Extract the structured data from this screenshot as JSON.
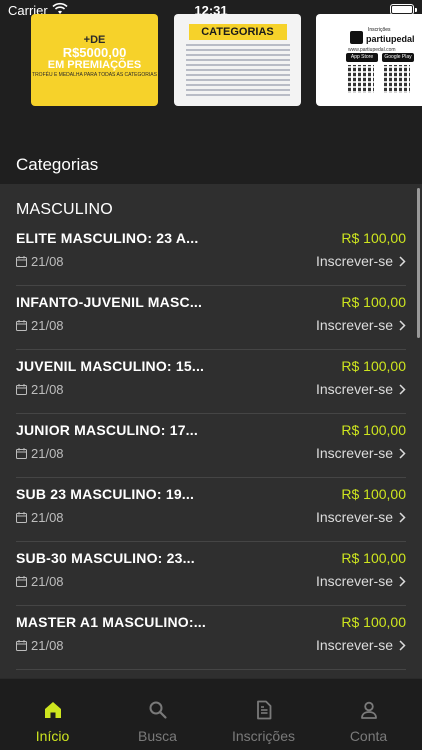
{
  "status_bar": {
    "carrier": "Carrier",
    "time": "12:31"
  },
  "banners": {
    "prize": {
      "line1": "+DE",
      "line2": "R$5000,00",
      "line3": "EM PREMIAÇÕES",
      "line4": "TROFÉU E MEDALHA PARA TODAS AS CATEGORIAS"
    },
    "categories": {
      "heading": "CATEGORIAS"
    },
    "app": {
      "inscricoes": "Inscrições",
      "brand": "partiupedal",
      "url": "www.partiupedal.com",
      "app_store": "App Store",
      "google_play": "Google Play"
    }
  },
  "section_title": "Categorias",
  "group_title": "MASCULINO",
  "categories": [
    {
      "name": "ELITE MASCULINO: 23 A...",
      "price": "R$ 100,00",
      "date": "21/08",
      "action": "Inscrever-se"
    },
    {
      "name": "INFANTO-JUVENIL MASC...",
      "price": "R$ 100,00",
      "date": "21/08",
      "action": "Inscrever-se"
    },
    {
      "name": "JUVENIL MASCULINO: 15...",
      "price": "R$ 100,00",
      "date": "21/08",
      "action": "Inscrever-se"
    },
    {
      "name": "JUNIOR MASCULINO: 17...",
      "price": "R$ 100,00",
      "date": "21/08",
      "action": "Inscrever-se"
    },
    {
      "name": "SUB 23 MASCULINO: 19...",
      "price": "R$ 100,00",
      "date": "21/08",
      "action": "Inscrever-se"
    },
    {
      "name": "SUB-30 MASCULINO: 23...",
      "price": "R$ 100,00",
      "date": "21/08",
      "action": "Inscrever-se"
    },
    {
      "name": "MASTER A1 MASCULINO:...",
      "price": "R$ 100,00",
      "date": "21/08",
      "action": "Inscrever-se"
    }
  ],
  "tabs": [
    {
      "label": "Início",
      "icon": "home-icon",
      "active": true
    },
    {
      "label": "Busca",
      "icon": "search-icon",
      "active": false
    },
    {
      "label": "Inscrições",
      "icon": "document-icon",
      "active": false
    },
    {
      "label": "Conta",
      "icon": "user-icon",
      "active": false
    }
  ],
  "colors": {
    "accent": "#cde51f",
    "background": "#1f1f1f",
    "list_background": "#2f2f2f",
    "banner_yellow": "#f6d22a"
  }
}
